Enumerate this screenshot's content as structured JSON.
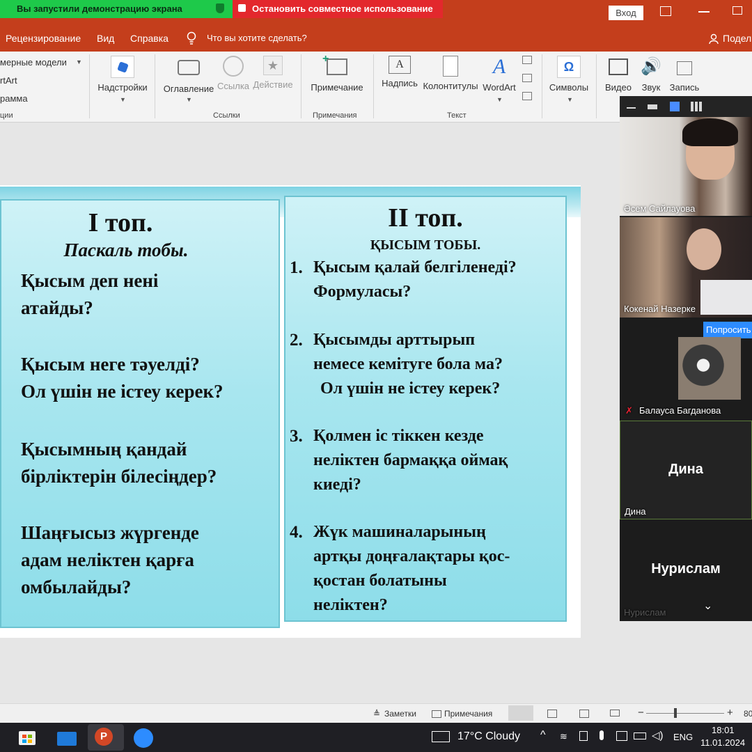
{
  "window": {
    "sharing_banner": "Вы запустили демонстрацию экрана",
    "stop_sharing": "Остановить совместное использование",
    "signin": "Вход",
    "share": "Подел"
  },
  "menu": {
    "items": [
      "Рецензирование",
      "Вид",
      "Справка"
    ],
    "tell_me": "Что вы хотите сделать?"
  },
  "ribbon": {
    "left_items": [
      "мерные модели",
      "rtArt",
      "рамма"
    ],
    "left_group": "ции",
    "addins": "Надстройки",
    "toc": "Оглавление",
    "link": "Ссылка",
    "action": "Действие",
    "links_group": "Ссылки",
    "comment": "Примечание",
    "comments_group": "Примечания",
    "textbox": "Надпись",
    "headerfooter": "Колонтитулы",
    "wordart": "WordArt",
    "text_group": "Текст",
    "symbols": "Символы",
    "video": "Видео",
    "audio": "Звук",
    "record": "Запись"
  },
  "slide": {
    "left": {
      "title": "I топ.",
      "subtitle": "Паскаль тобы.",
      "questions": [
        [
          "Қысым деп нені",
          "атайды?"
        ],
        [
          "Қысым неге тәуелді?",
          "Ол үшін не істеу керек?"
        ],
        [
          "Қысымның қандай",
          "бірліктерін білесіңдер?"
        ],
        [
          "Шаңғысыз жүргенде",
          "адам неліктен қарға",
          "омбылайды?"
        ]
      ]
    },
    "right": {
      "title": "II топ.",
      "subtitle": "ҚЫСЫМ ТОБЫ.",
      "numbers": [
        "1.",
        "2.",
        "3.",
        "4."
      ],
      "questions": [
        [
          "Қысым қалай белгіленеді?",
          "Формуласы?"
        ],
        [
          "Қысымды арттырып",
          "немесе кемітуге бола ма?",
          "Ол үшін не істеу керек?"
        ],
        [
          "Қолмен іс тіккен кезде",
          "неліктен бармаққа оймақ",
          "киеді?"
        ],
        [
          "Жүк машиналарының",
          "артқы доңғалақтары қос-",
          "қостан болатыны",
          "неліктен?"
        ]
      ]
    }
  },
  "zoom": {
    "participants": [
      {
        "name": "Әсем Сайлауова"
      },
      {
        "name": "Кокенай Назерке"
      },
      {
        "name": "Балауса Багданова"
      },
      {
        "name": "Дина",
        "big": "Дина"
      },
      {
        "name": "Нурислам",
        "big": "Нурислам"
      }
    ],
    "request_button": "Попросить"
  },
  "statusbar": {
    "notes": "Заметки",
    "comments": "Примечания",
    "zoom_level": "80"
  },
  "taskbar": {
    "weather": "17°C  Cloudy",
    "language": "ENG",
    "time": "18:01",
    "date": "11.01.2024"
  },
  "colors": {
    "accent": "#c43e1c",
    "sharing": "#1ec94a",
    "stop": "#e3282d",
    "card": "#a8e6ef"
  }
}
